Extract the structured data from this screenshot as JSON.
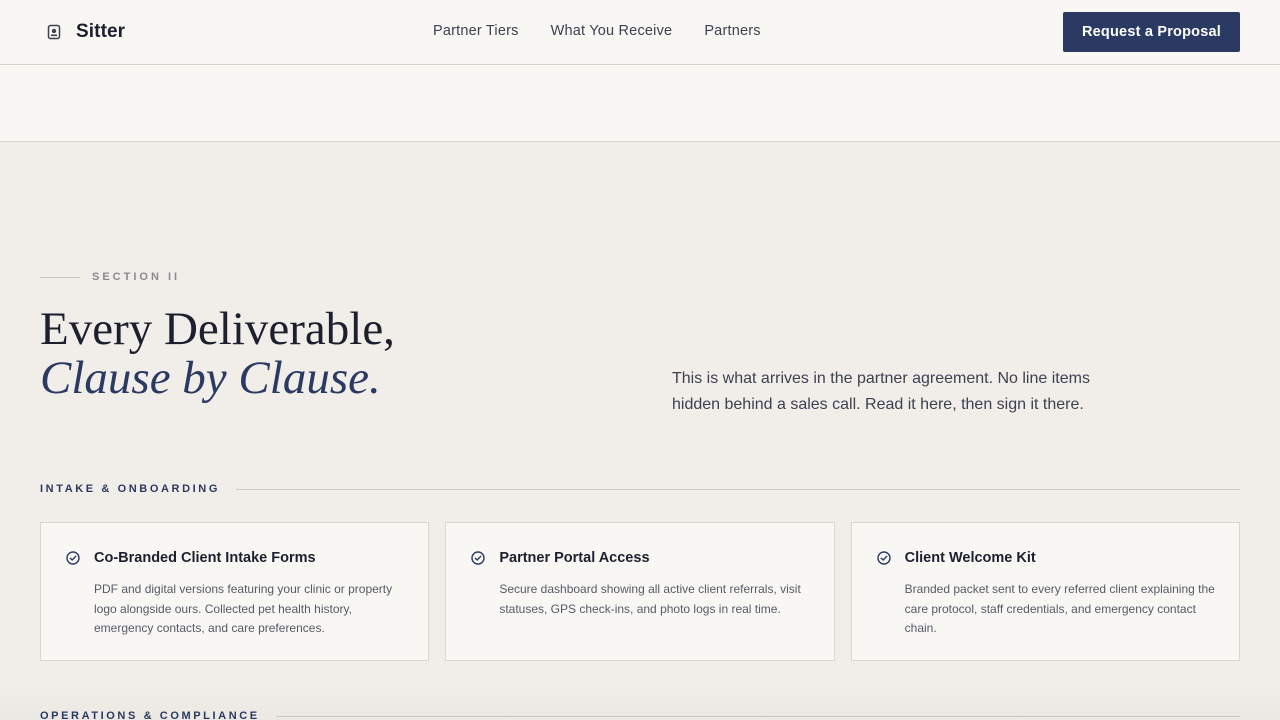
{
  "brand": {
    "name": "Sitter",
    "logo_icon": "badge-icon"
  },
  "nav": {
    "items": [
      "Partner Tiers",
      "What You Receive",
      "Partners"
    ]
  },
  "cta": {
    "label": "Request a Proposal"
  },
  "section": {
    "eyebrow": "SECTION II",
    "headline_line1": "Every Deliverable,",
    "headline_line2": "Clause by Clause.",
    "intro": "This is what arrives in the partner agreement. No line items hidden behind a sales call. Read it here, then sign it there."
  },
  "groups": [
    {
      "title": "INTAKE & ONBOARDING",
      "cards": [
        {
          "title": "Co-Branded Client Intake Forms",
          "body": "PDF and digital versions featuring your clinic or property logo alongside ours. Collected pet health history, emergency contacts, and care preferences.",
          "icon": "check-circle-icon"
        },
        {
          "title": "Partner Portal Access",
          "body": "Secure dashboard showing all active client referrals, visit statuses, GPS check-ins, and photo logs in real time.",
          "icon": "check-circle-icon"
        },
        {
          "title": "Client Welcome Kit",
          "body": "Branded packet sent to every referred client explaining the care protocol, staff credentials, and emergency contact chain.",
          "icon": "check-circle-icon"
        }
      ]
    },
    {
      "title": "OPERATIONS & COMPLIANCE"
    }
  ],
  "colors": {
    "accent": "#2a3a63",
    "background": "#f1eee9",
    "surface": "#f8f7f4",
    "text": "#1c1f2e"
  }
}
